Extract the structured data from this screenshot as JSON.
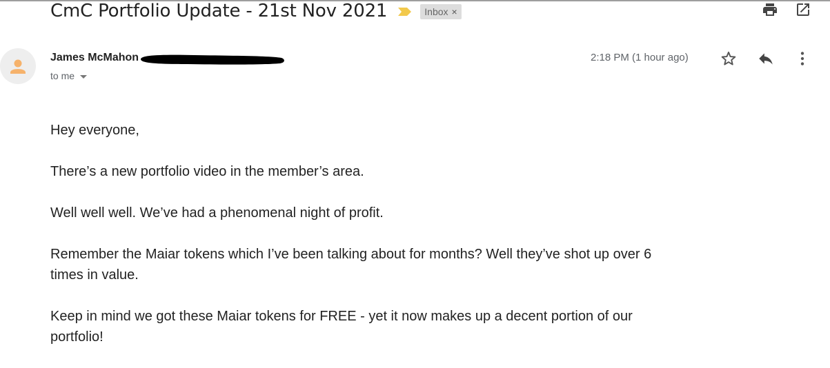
{
  "email": {
    "subject": "CmC Portfolio Update - 21st Nov 2021",
    "label": "Inbox",
    "label_remove_glyph": "×",
    "sender_name": "James McMahon",
    "recipient_text": "to me",
    "timestamp": "2:18 PM (1 hour ago)",
    "body": [
      "Hey everyone,",
      "There’s a new portfolio video in the member’s area.",
      "Well well well. We’ve had a phenomenal night of profit.",
      "Remember the Maiar tokens which I’ve been talking about for months? Well they’ve shot up over 6 times in value.",
      "Keep in mind we got these Maiar tokens for FREE - yet it now makes up a decent portion of our portfolio!"
    ]
  },
  "icons": {
    "importance_marker": "importance-marker-icon",
    "print": "print-icon",
    "open_new_window": "open-in-new-window-icon",
    "avatar": "person-avatar-icon",
    "recipient_dropdown": "caret-down-icon",
    "star": "star-icon",
    "reply": "reply-icon",
    "more": "more-vertical-icon"
  },
  "colors": {
    "importance_marker": "#f2c94c",
    "avatar_person": "#f6b26b",
    "avatar_background": "#eeeeee",
    "label_chip_background": "#dddddd",
    "secondary_text": "#5f6368",
    "redaction": "#000000"
  }
}
